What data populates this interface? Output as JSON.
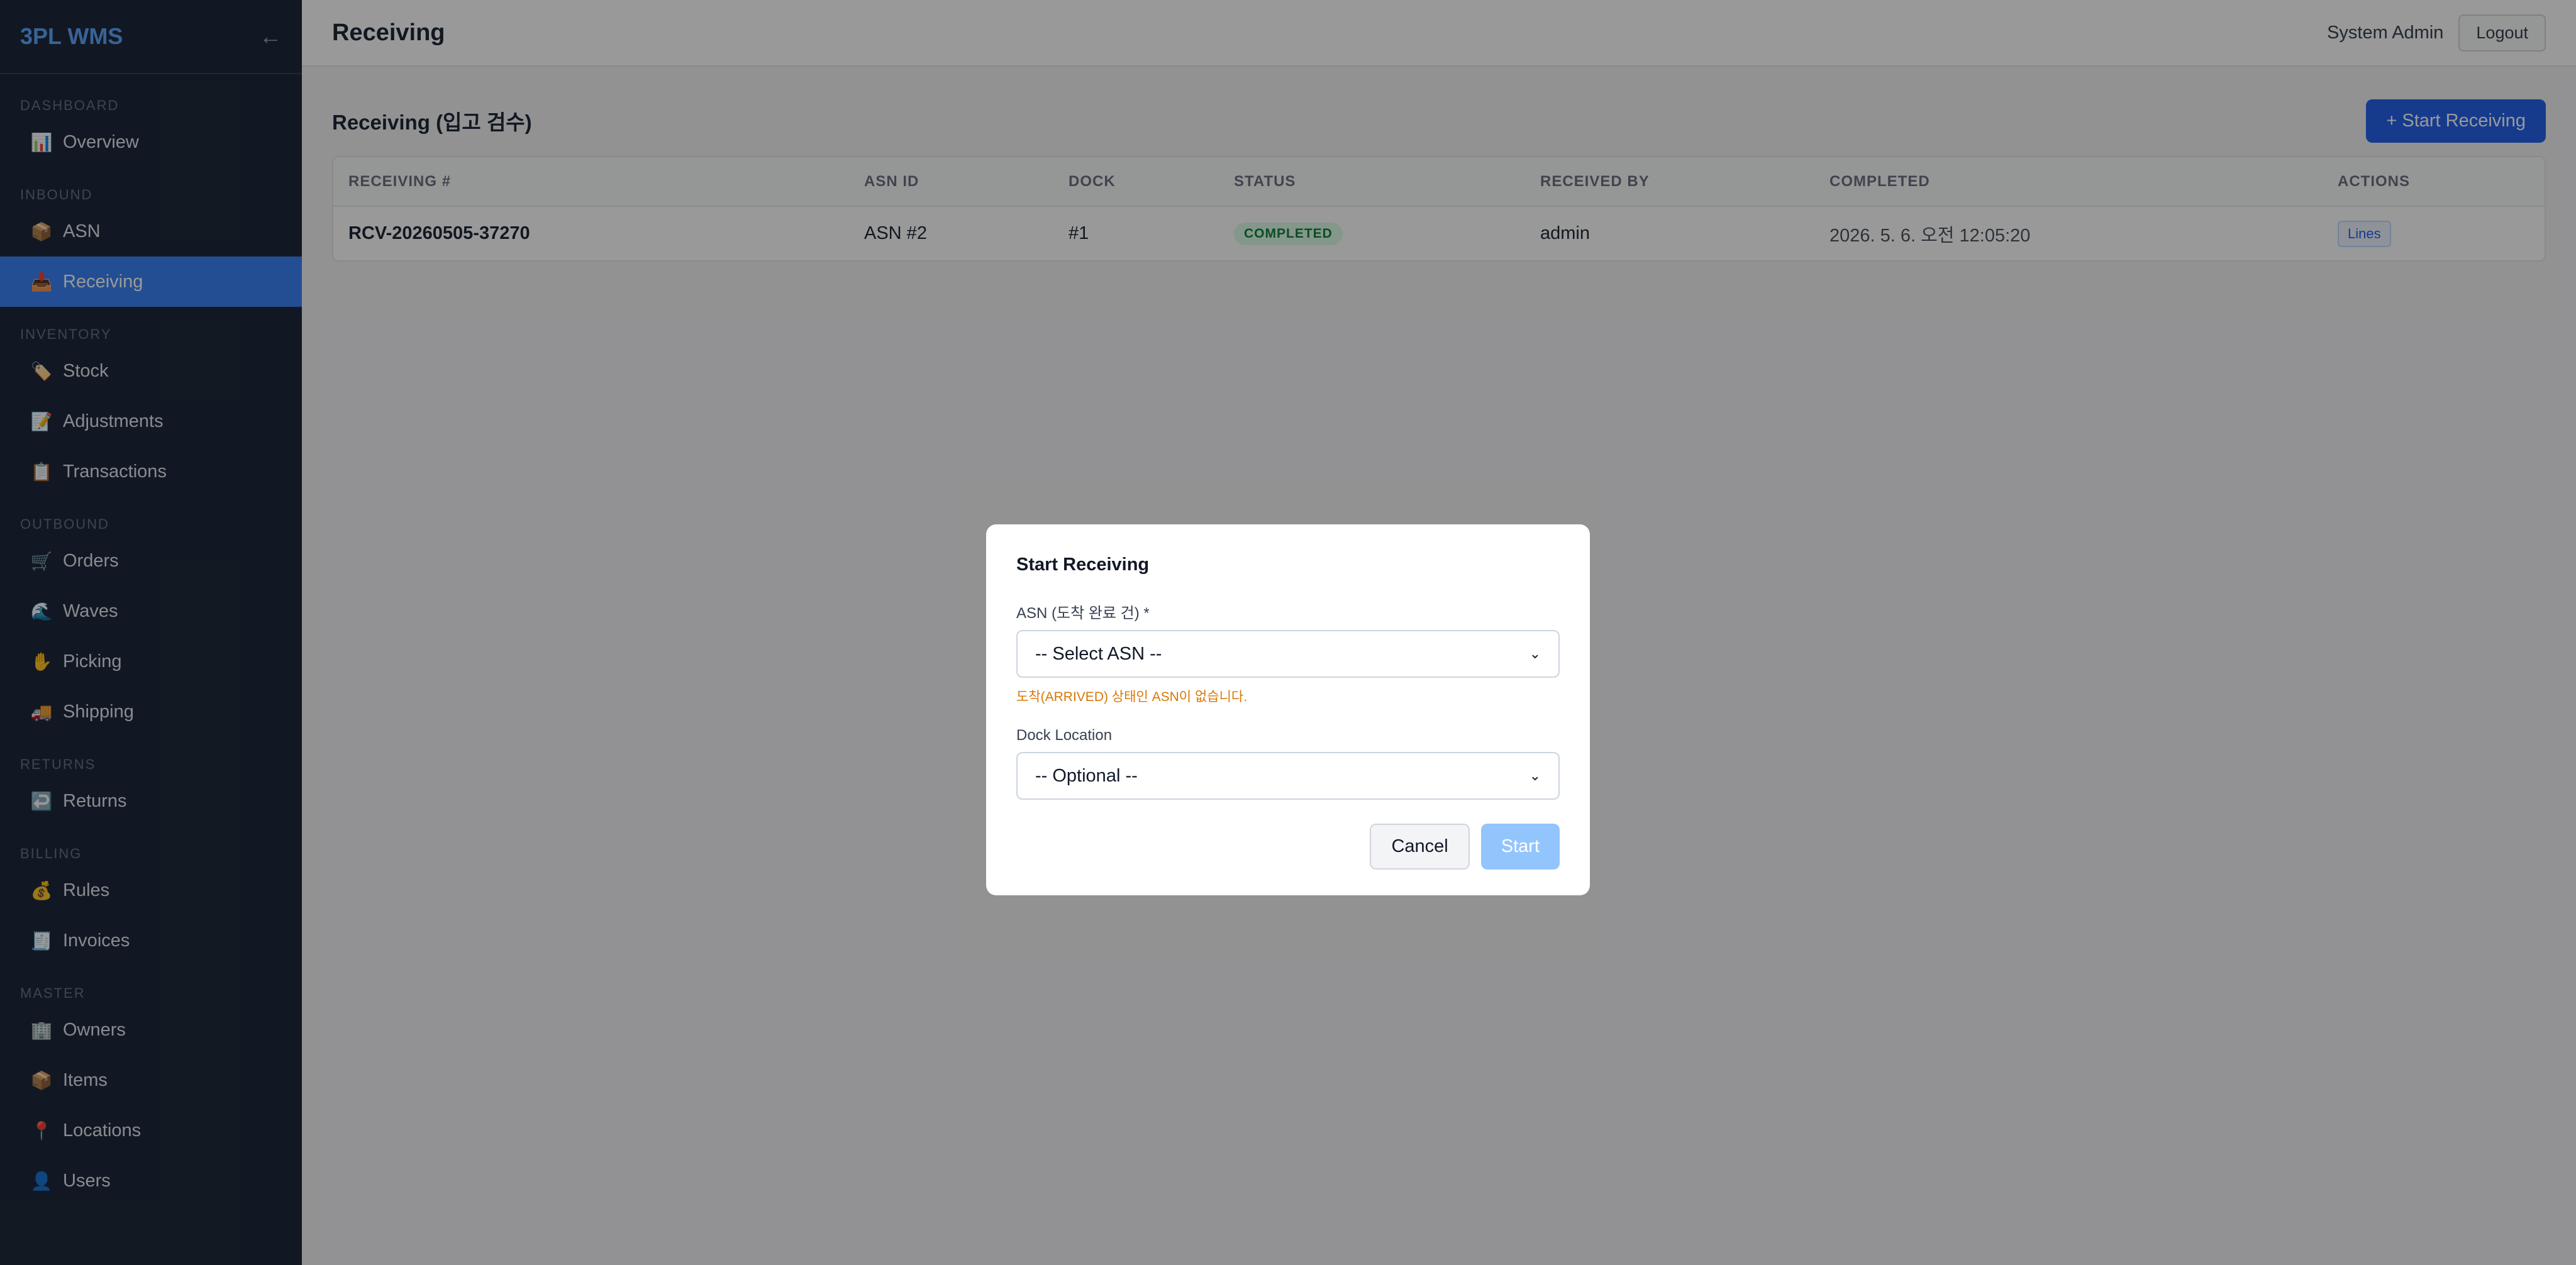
{
  "sidebar": {
    "brand": "3PL WMS",
    "collapse_icon": "←",
    "sections": [
      {
        "label": "DASHBOARD",
        "items": [
          {
            "icon": "📊",
            "label": "Overview"
          }
        ]
      },
      {
        "label": "INBOUND",
        "items": [
          {
            "icon": "📦",
            "label": "ASN"
          },
          {
            "icon": "📥",
            "label": "Receiving",
            "active": true
          }
        ]
      },
      {
        "label": "INVENTORY",
        "items": [
          {
            "icon": "🏷️",
            "label": "Stock"
          },
          {
            "icon": "📝",
            "label": "Adjustments"
          },
          {
            "icon": "📋",
            "label": "Transactions"
          }
        ]
      },
      {
        "label": "OUTBOUND",
        "items": [
          {
            "icon": "🛒",
            "label": "Orders"
          },
          {
            "icon": "🌊",
            "label": "Waves"
          },
          {
            "icon": "✋",
            "label": "Picking"
          },
          {
            "icon": "🚚",
            "label": "Shipping"
          }
        ]
      },
      {
        "label": "RETURNS",
        "items": [
          {
            "icon": "↩️",
            "label": "Returns"
          }
        ]
      },
      {
        "label": "BILLING",
        "items": [
          {
            "icon": "💰",
            "label": "Rules"
          },
          {
            "icon": "🧾",
            "label": "Invoices"
          }
        ]
      },
      {
        "label": "MASTER",
        "items": [
          {
            "icon": "🏢",
            "label": "Owners"
          },
          {
            "icon": "📦",
            "label": "Items"
          },
          {
            "icon": "📍",
            "label": "Locations"
          },
          {
            "icon": "👤",
            "label": "Users"
          }
        ]
      }
    ]
  },
  "header": {
    "title": "Receiving",
    "user": "System Admin",
    "logout": "Logout"
  },
  "content": {
    "title": "Receiving (입고 검수)",
    "start_button": "+ Start Receiving",
    "columns": [
      "RECEIVING #",
      "ASN ID",
      "DOCK",
      "STATUS",
      "RECEIVED BY",
      "COMPLETED",
      "ACTIONS"
    ],
    "rows": [
      {
        "receiving_no": "RCV-20260505-37270",
        "asn_id": "ASN #2",
        "dock": "#1",
        "status": "COMPLETED",
        "received_by": "admin",
        "completed": "2026. 5. 6. 오전 12:05:20",
        "action": "Lines"
      }
    ]
  },
  "modal": {
    "title": "Start Receiving",
    "asn_label": "ASN (도착 완료 건) *",
    "asn_selected": "-- Select ASN --",
    "asn_warning": "도착(ARRIVED) 상태인 ASN이 없습니다.",
    "dock_label": "Dock Location",
    "dock_selected": "-- Optional --",
    "cancel": "Cancel",
    "start": "Start"
  },
  "colors": {
    "sidebar_bg": "#1e293b",
    "accent": "#3b82f6",
    "brand": "#60a5fa",
    "warning": "#d97706",
    "status_completed": "#15803d"
  }
}
